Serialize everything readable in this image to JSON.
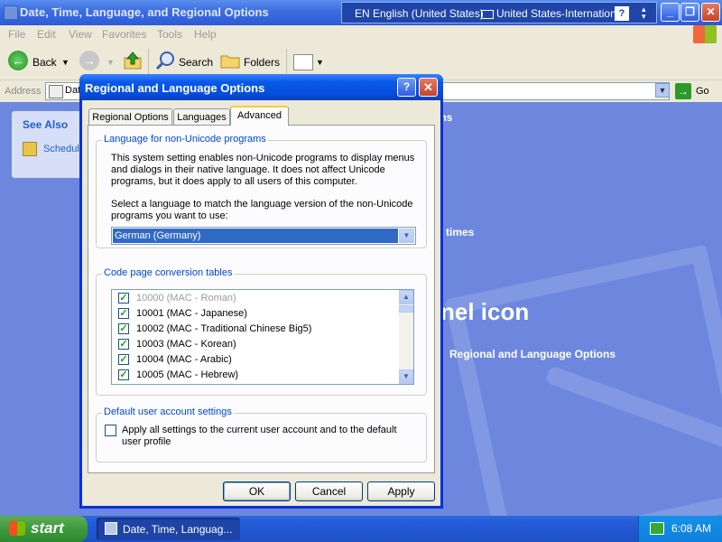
{
  "window": {
    "title": "Date, Time, Language, and Regional Options",
    "minimize": "_",
    "restore": "❐",
    "close": "✕"
  },
  "language_bar": {
    "language": "EN English (United States)",
    "keyboard": "United States-International",
    "help": "?"
  },
  "menu": [
    "File",
    "Edit",
    "View",
    "Favorites",
    "Tools",
    "Help"
  ],
  "toolbar": {
    "back": "Back",
    "search": "Search",
    "folders": "Folders"
  },
  "address": {
    "label": "Address",
    "value": "Dat",
    "go": "Go"
  },
  "see_also": {
    "header": "See Also",
    "item": "Schedule"
  },
  "content": {
    "fragment_options": "ons",
    "fragment_times": "times",
    "fragment_icon": "nel icon",
    "link": "Regional and Language Options"
  },
  "dialog": {
    "title": "Regional and Language Options",
    "help": "?",
    "close": "✕",
    "tabs": [
      {
        "label": "Regional Options",
        "active": false
      },
      {
        "label": "Languages",
        "active": false
      },
      {
        "label": "Advanced",
        "active": true
      }
    ],
    "non_unicode": {
      "legend": "Language for non-Unicode programs",
      "desc_lines": [
        "This system setting enables non-Unicode programs to display menus",
        "and dialogs in their native language. It does not affect Unicode",
        "programs, but it does apply to all users of this computer."
      ],
      "select_lines": [
        "Select a language to match the language version of the non-Unicode",
        "programs you want to use:"
      ],
      "selected_language": "German (Germany)"
    },
    "code_pages": {
      "legend": "Code page conversion tables",
      "items": [
        {
          "label": "10000 (MAC - Roman)",
          "checked": true,
          "dimmed": true
        },
        {
          "label": "10001 (MAC - Japanese)",
          "checked": true,
          "dimmed": false
        },
        {
          "label": "10002 (MAC - Traditional Chinese Big5)",
          "checked": true,
          "dimmed": false
        },
        {
          "label": "10003 (MAC - Korean)",
          "checked": true,
          "dimmed": false
        },
        {
          "label": "10004 (MAC - Arabic)",
          "checked": true,
          "dimmed": false
        },
        {
          "label": "10005 (MAC - Hebrew)",
          "checked": true,
          "dimmed": false
        }
      ]
    },
    "default_user": {
      "legend": "Default user account settings",
      "checkbox_lines": [
        "Apply all settings to the current user account and to the default",
        "user profile"
      ]
    },
    "buttons": {
      "ok": "OK",
      "cancel": "Cancel",
      "apply": "Apply"
    }
  },
  "taskbar": {
    "start": "start",
    "task": "Date, Time, Languag...",
    "clock": "6:08 AM"
  }
}
